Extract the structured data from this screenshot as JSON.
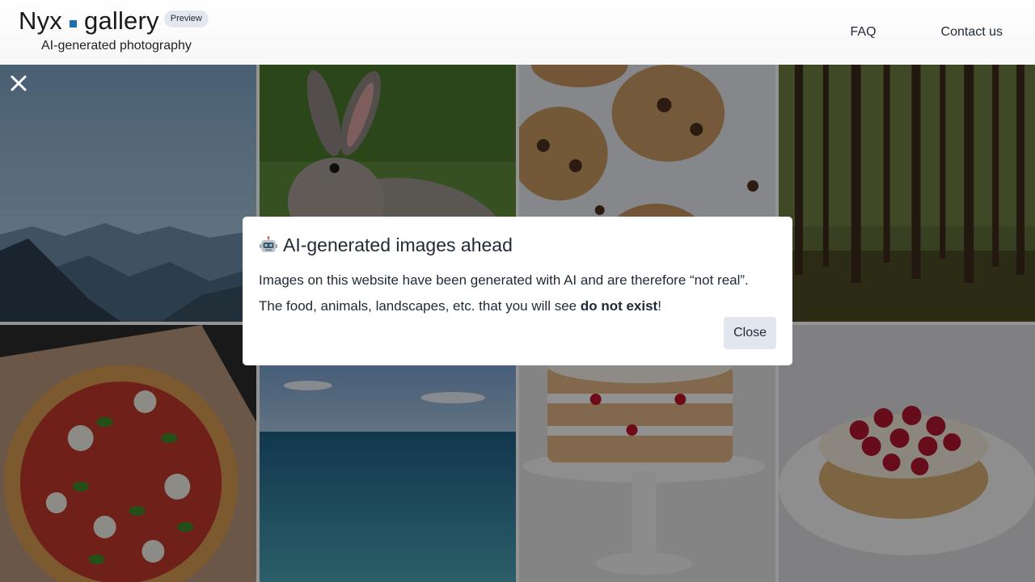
{
  "header": {
    "brand_first": "Nyx",
    "brand_second": "gallery",
    "badge": "Preview",
    "tagline": "AI-generated photography",
    "nav": [
      {
        "label": "FAQ"
      },
      {
        "label": "Contact us"
      }
    ]
  },
  "overlay": {
    "close_icon": "close-icon"
  },
  "modal": {
    "icon": "robot-icon",
    "title": "AI-generated images ahead",
    "line1": "Images on this website have been generated with AI and are therefore “not real”.",
    "line2_prefix": "The food, animals, landscapes, etc. that you will see ",
    "line2_bold": "do not exist",
    "line2_suffix": "!",
    "close_label": "Close"
  },
  "gallery": {
    "tiles": [
      "mountains",
      "rabbit",
      "cookies",
      "forest",
      "pizza",
      "ocean",
      "layer-cake",
      "raspberry-tart"
    ]
  },
  "colors": {
    "accent": "#1e6fb0",
    "badge_bg": "#e3e7ee",
    "button_bg": "#e2e7ef"
  }
}
